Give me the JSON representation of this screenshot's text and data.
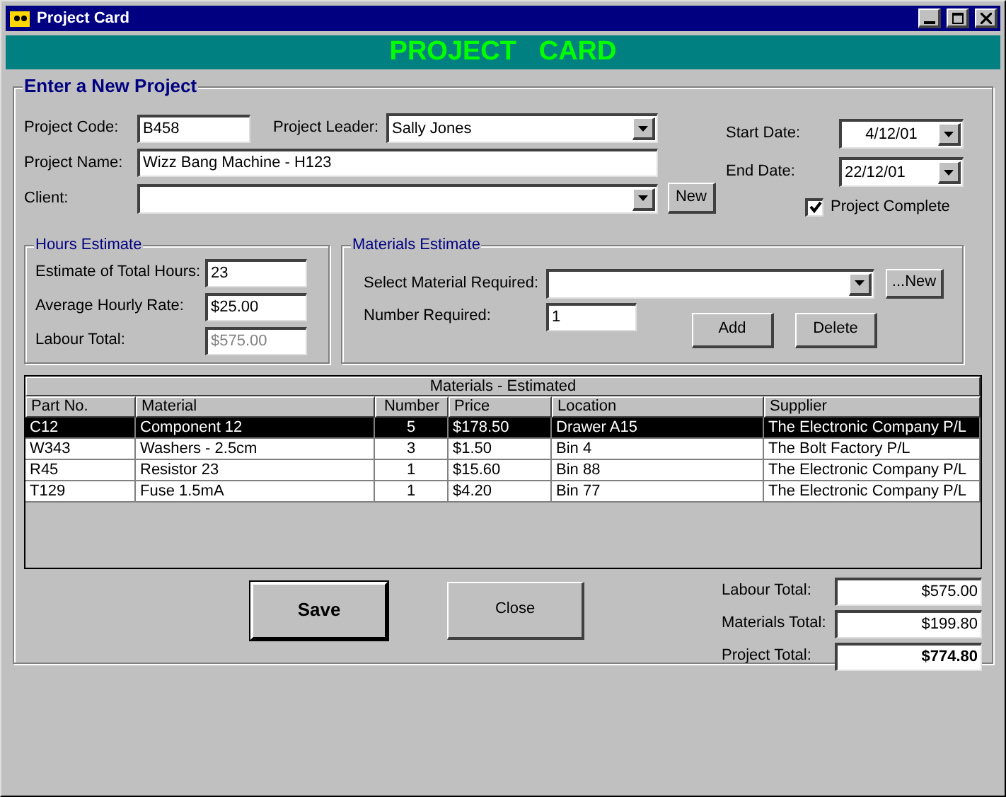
{
  "window": {
    "title": "Project Card"
  },
  "banner": "PROJECT   CARD",
  "project": {
    "title": "Enter a New Project",
    "code": {
      "label": "Project Code:",
      "value": "B458"
    },
    "leader": {
      "label": "Project Leader:",
      "value": "Sally Jones"
    },
    "name": {
      "label": "Project Name:",
      "value": "Wizz Bang Machine - H123"
    },
    "client": {
      "label": "Client:",
      "new_button": "New"
    },
    "start_date": {
      "label": "Start Date:",
      "value": "4/12/01"
    },
    "end_date": {
      "label": "End Date:",
      "value": "22/12/01"
    },
    "complete": {
      "label": "Project Complete",
      "checked": true
    }
  },
  "hours": {
    "title": "Hours Estimate",
    "fields": [
      {
        "label": "Estimate of Total Hours:",
        "value": "23",
        "disabled": false
      },
      {
        "label": "Average Hourly Rate:",
        "value": "$25.00",
        "disabled": false
      },
      {
        "label": "Labour Total:",
        "value": "$575.00",
        "disabled": true
      }
    ]
  },
  "materials": {
    "title": "Materials Estimate",
    "select_label": "Select Material Required:",
    "new_button": {
      "label": "...New"
    },
    "number_label": "Number Required:",
    "number_value": "1",
    "buttons": [
      {
        "label": "Add"
      },
      {
        "label": "Delete"
      }
    ]
  },
  "table": {
    "title": "Materials - Estimated",
    "columns": [
      "Part No.",
      "Material",
      "Number",
      "Price",
      "Location",
      "Supplier"
    ],
    "rows": [
      {
        "selected": true,
        "cells": [
          "C12",
          "Component 12",
          "5",
          "$178.50",
          "Drawer A15",
          "The Electronic Company P/L"
        ]
      },
      {
        "selected": false,
        "cells": [
          "W343",
          "Washers - 2.5cm",
          "3",
          "$1.50",
          "Bin 4",
          "The Bolt Factory P/L"
        ]
      },
      {
        "selected": false,
        "cells": [
          "R45",
          "Resistor 23",
          "1",
          "$15.60",
          "Bin 88",
          "The Electronic Company P/L"
        ]
      },
      {
        "selected": false,
        "cells": [
          "T129",
          "Fuse 1.5mA",
          "1",
          "$4.20",
          "Bin 77",
          "The Electronic Company P/L"
        ]
      }
    ]
  },
  "buttons": [
    {
      "label": "Save",
      "default": true
    },
    {
      "label": "Close",
      "default": false
    }
  ],
  "totals": [
    {
      "label": "Labour Total:",
      "value": "$575.00",
      "bold": false
    },
    {
      "label": "Materials Total:",
      "value": "$199.80",
      "bold": false
    },
    {
      "label": "Project Total:",
      "value": "$774.80",
      "bold": true
    }
  ]
}
